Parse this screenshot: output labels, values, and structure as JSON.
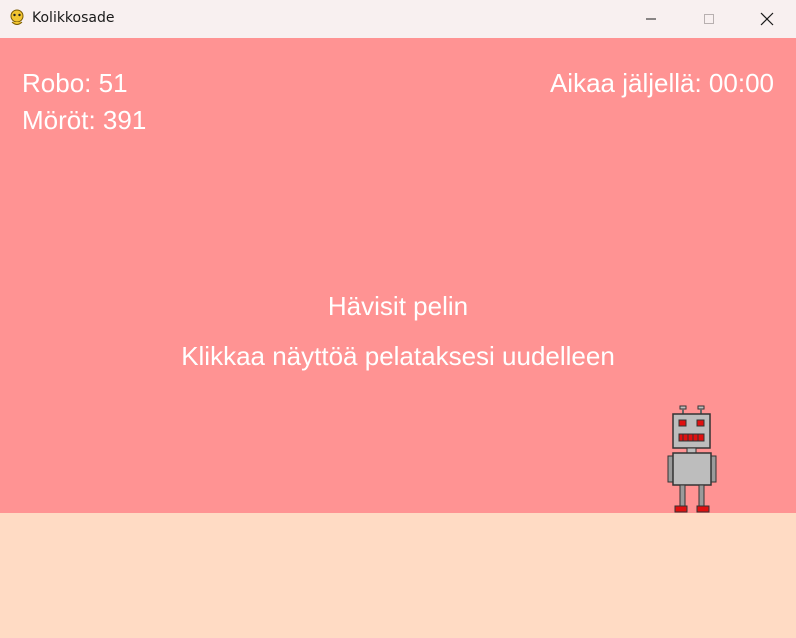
{
  "window": {
    "title": "Kolikkosade"
  },
  "hud": {
    "robo": "Robo: 51",
    "morot": "Möröt: 391",
    "time_left": "Aikaa jäljellä: 00:00"
  },
  "message": {
    "line1": "Hävisit pelin",
    "line2": "Klikkaa näyttöä pelataksesi uudelleen"
  },
  "icons": {
    "app": "python-snake-icon",
    "minimize": "minimize-icon",
    "maximize": "maximize-icon",
    "close": "close-icon",
    "player": "robot-sprite"
  },
  "colors": {
    "sky": "#ff9393",
    "ground": "#ffdbc4",
    "text": "#ffffff"
  }
}
